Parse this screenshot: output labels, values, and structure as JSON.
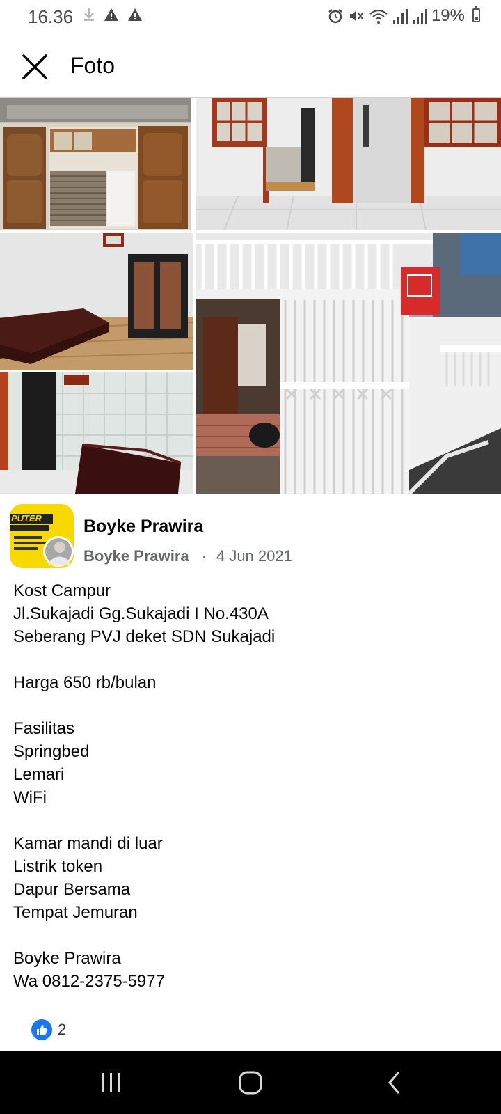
{
  "status_bar": {
    "time": "16.36",
    "battery": "19%",
    "icons_left": [
      "download-icon",
      "alert-icon",
      "alert-icon"
    ],
    "icons_right": [
      "alarm-icon",
      "mute-icon",
      "wifi-icon",
      "signal-icon",
      "signal-icon",
      "battery-icon"
    ]
  },
  "header": {
    "title": "Foto"
  },
  "photos": [
    {
      "name": "kitchen-doors"
    },
    {
      "name": "hallway-doors"
    },
    {
      "name": "bedroom-bed-wardrobe"
    },
    {
      "name": "building-gate"
    },
    {
      "name": "tiled-room-bed"
    }
  ],
  "post": {
    "author": "Boyke Prawira",
    "meta_name": "Boyke Prawira",
    "separator": "·",
    "date": "4 Jun 2021",
    "lines": [
      "Kost Campur",
      "Jl.Sukajadi Gg.Sukajadi I No.430A",
      "Seberang PVJ deket SDN Sukajadi",
      "",
      "Harga 650 rb/bulan",
      "",
      "Fasilitas",
      "Springbed",
      "Lemari",
      "WiFi",
      "",
      "Kamar mandi di luar",
      "Listrik token",
      "Dapur Bersama",
      "Tempat Jemuran",
      "",
      "Boyke Prawira",
      "Wa 0812-2375-5977"
    ],
    "like_count": "2"
  },
  "colors": {
    "accent": "#1877f2",
    "text": "#050505",
    "meta": "#65676b",
    "nav_bg": "#000000"
  }
}
